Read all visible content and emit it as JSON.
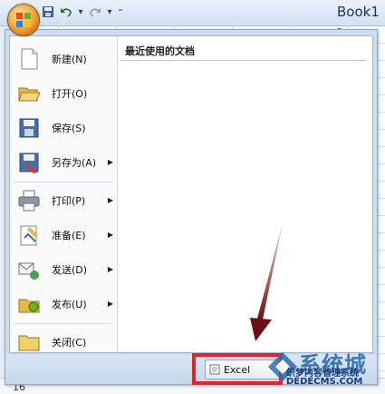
{
  "window": {
    "title": "Book1 -"
  },
  "quick_access": {
    "undo_icon": "undo-icon",
    "redo_icon": "redo-icon",
    "save_icon": "save-icon",
    "customize_icon": "customize-arrow-icon"
  },
  "menu": {
    "items": [
      {
        "label": "新建(N)",
        "icon": "new-document-icon",
        "has_submenu": false
      },
      {
        "label": "打开(O)",
        "icon": "open-folder-icon",
        "has_submenu": false
      },
      {
        "label": "保存(S)",
        "icon": "save-disk-icon",
        "has_submenu": false
      },
      {
        "label": "另存为(A)",
        "icon": "save-as-icon",
        "has_submenu": true
      },
      {
        "label": "打印(P)",
        "icon": "printer-icon",
        "has_submenu": true
      },
      {
        "label": "准备(E)",
        "icon": "prepare-icon",
        "has_submenu": true
      },
      {
        "label": "发送(D)",
        "icon": "send-icon",
        "has_submenu": true
      },
      {
        "label": "发布(U)",
        "icon": "publish-icon",
        "has_submenu": true
      },
      {
        "label": "关闭(C)",
        "icon": "close-folder-icon",
        "has_submenu": false
      }
    ],
    "recent_title": "最近使用的文档"
  },
  "bottom": {
    "options_label": "Excel"
  },
  "sheet": {
    "row_number": "16"
  },
  "watermark": {
    "big": "系统城",
    "small": "织梦内容管理系统",
    "url": "DEDECMS.COM"
  },
  "colors": {
    "annotation_red": "#e0242c",
    "arrow": "#7a1416"
  }
}
